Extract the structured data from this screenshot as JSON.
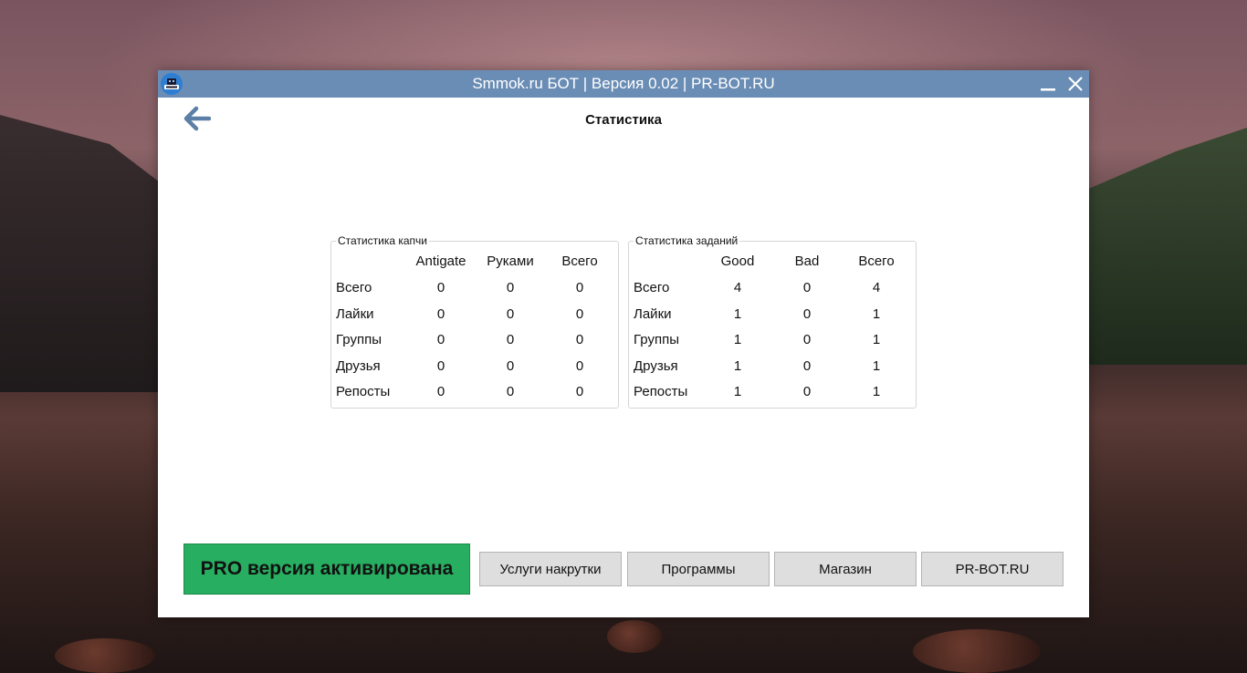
{
  "window": {
    "title": "Smmok.ru БОТ | Версия 0.02 | PR-BOT.RU"
  },
  "page": {
    "title": "Статистика"
  },
  "captcha_stats": {
    "group_title": "Статистика капчи",
    "columns": [
      "Antigate",
      "Руками",
      "Всего"
    ],
    "rows": [
      {
        "label": "Всего",
        "values": [
          "0",
          "0",
          "0"
        ]
      },
      {
        "label": "Лайки",
        "values": [
          "0",
          "0",
          "0"
        ]
      },
      {
        "label": "Группы",
        "values": [
          "0",
          "0",
          "0"
        ]
      },
      {
        "label": "Друзья",
        "values": [
          "0",
          "0",
          "0"
        ]
      },
      {
        "label": "Репосты",
        "values": [
          "0",
          "0",
          "0"
        ]
      }
    ]
  },
  "task_stats": {
    "group_title": "Статистика заданий",
    "columns": [
      "Good",
      "Bad",
      "Всего"
    ],
    "rows": [
      {
        "label": "Всего",
        "values": [
          "4",
          "0",
          "4"
        ]
      },
      {
        "label": "Лайки",
        "values": [
          "1",
          "0",
          "1"
        ]
      },
      {
        "label": "Группы",
        "values": [
          "1",
          "0",
          "1"
        ]
      },
      {
        "label": "Друзья",
        "values": [
          "1",
          "0",
          "1"
        ]
      },
      {
        "label": "Репосты",
        "values": [
          "1",
          "0",
          "1"
        ]
      }
    ]
  },
  "footer": {
    "pro_label": "PRO версия активирована",
    "buttons": [
      "Услуги накрутки",
      "Программы",
      "Магазин",
      "PR-BOT.RU"
    ]
  },
  "colors": {
    "titlebar": "#6a8db5",
    "pro_green": "#27ae60",
    "button_gray": "#dedede",
    "back_arrow": "#5b7fa6"
  },
  "icons": {
    "app": "robot-icon",
    "back": "arrow-left-icon",
    "minimize": "minimize-icon",
    "close": "close-icon"
  }
}
